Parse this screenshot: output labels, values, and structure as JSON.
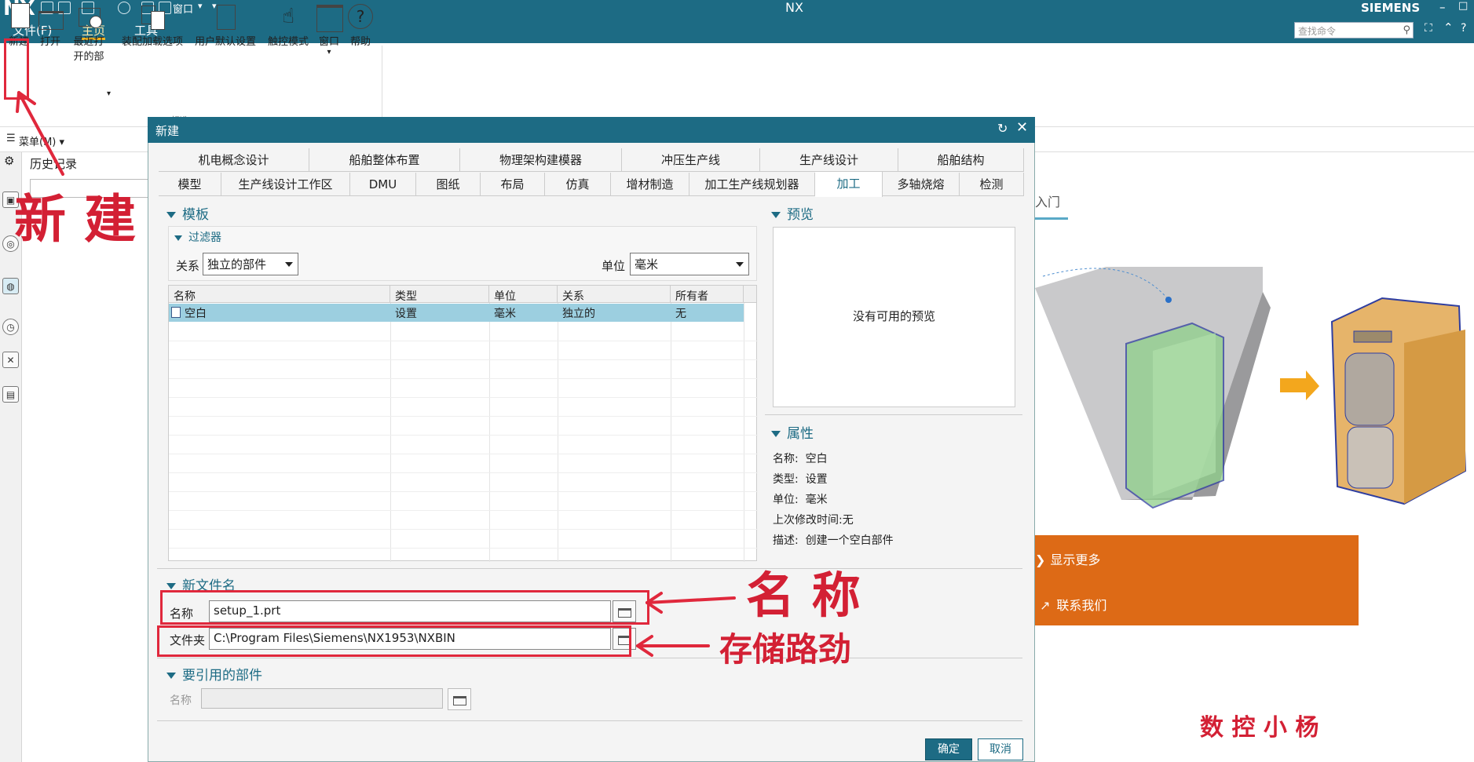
{
  "titlebar": {
    "logo": "NX",
    "window_menu_label": "窗口",
    "app_title": "NX",
    "brand": "SIEMENS",
    "search_placeholder": "查找命令"
  },
  "menu_tabs": [
    "文件(F)",
    "主页",
    "工具"
  ],
  "ribbon": {
    "buttons": [
      {
        "label": "新建",
        "icon": "new-file-icon"
      },
      {
        "label": "打开",
        "icon": "open-folder-icon"
      },
      {
        "label": "最近打",
        "label2": "开的部",
        "icon": "recent-files-icon"
      },
      {
        "label": "装配加载选项",
        "icon": "assembly-load-icon"
      },
      {
        "label": "用户默认设置",
        "icon": "user-defaults-icon"
      },
      {
        "label": "触控模式",
        "icon": "touch-mode-icon"
      },
      {
        "label": "窗口",
        "icon": "window-icon"
      },
      {
        "label": "帮助",
        "icon": "help-icon"
      }
    ],
    "group_label": "标准"
  },
  "menu_bar": {
    "menu_label": "菜单(M)",
    "history_label": "历史记录"
  },
  "right_panel": {
    "tab_label": "入门",
    "show_more": "显示更多",
    "contact_us": "联系我们"
  },
  "dialog": {
    "title": "新建",
    "tabs_row1": [
      "机电概念设计",
      "船舶整体布置",
      "物理架构建模器",
      "冲压生产线",
      "生产线设计",
      "船舶结构"
    ],
    "tabs_row2": [
      "模型",
      "生产线设计工作区",
      "DMU",
      "图纸",
      "布局",
      "仿真",
      "增材制造",
      "加工生产线规划器",
      "加工",
      "多轴烧熔",
      "检测"
    ],
    "active_tab": "加工",
    "template_section": "模板",
    "filter_section": "过滤器",
    "relation_label": "关系",
    "relation_value": "独立的部件",
    "unit_label": "单位",
    "unit_value": "毫米",
    "table": {
      "columns": [
        "名称",
        "类型",
        "单位",
        "关系",
        "所有者"
      ],
      "rows": [
        [
          "空白",
          "设置",
          "毫米",
          "独立的",
          "无"
        ]
      ]
    },
    "preview_section": "预览",
    "preview_empty": "没有可用的预览",
    "properties_section": "属性",
    "properties": [
      {
        "k": "名称:",
        "v": "空白"
      },
      {
        "k": "类型:",
        "v": "设置"
      },
      {
        "k": "单位:",
        "v": "毫米"
      },
      {
        "k": "上次修改时间:",
        "v": "无"
      },
      {
        "k": "描述:",
        "v": "创建一个空白部件"
      }
    ],
    "new_filename_section": "新文件名",
    "name_label": "名称",
    "name_value": "setup_1.prt",
    "folder_label": "文件夹",
    "folder_value": "C:\\Program Files\\Siemens\\NX1953\\NXBIN",
    "ref_part_section": "要引用的部件",
    "ref_name_label": "名称",
    "ok": "确定",
    "cancel": "取消"
  },
  "annotations": {
    "new_label": "新 建",
    "name_label": "名 称",
    "path_label": "存储路劲",
    "signature": "数 控 小 杨"
  },
  "colors": {
    "accent": "#1d6b84",
    "selection": "#9ccfe0",
    "annotation": "#e0283c",
    "orange": "#dd6a16"
  }
}
